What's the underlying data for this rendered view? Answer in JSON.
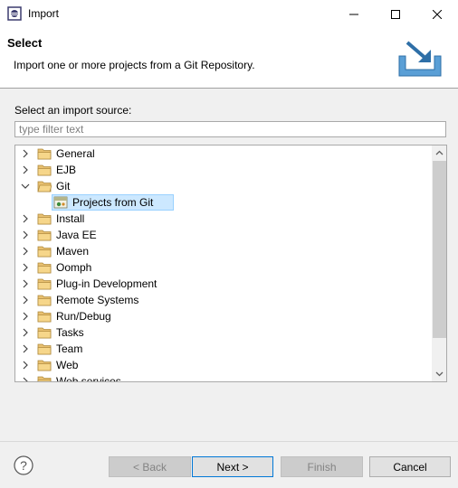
{
  "window": {
    "title": "Import",
    "icon": "eclipse-icon"
  },
  "header": {
    "title": "Select",
    "description": "Import one or more projects from a Git Repository.",
    "icon": "import-wizard-icon"
  },
  "main": {
    "source_label": "Select an import source:",
    "filter_placeholder": "type filter text",
    "tree": [
      {
        "label": "General",
        "expanded": false,
        "level": 0
      },
      {
        "label": "EJB",
        "expanded": false,
        "level": 0
      },
      {
        "label": "Git",
        "expanded": true,
        "level": 0
      },
      {
        "label": "Projects from Git",
        "level": 1,
        "selected": true,
        "icon": "git-repository-icon"
      },
      {
        "label": "Install",
        "expanded": false,
        "level": 0
      },
      {
        "label": "Java EE",
        "expanded": false,
        "level": 0
      },
      {
        "label": "Maven",
        "expanded": false,
        "level": 0
      },
      {
        "label": "Oomph",
        "expanded": false,
        "level": 0
      },
      {
        "label": "Plug-in Development",
        "expanded": false,
        "level": 0
      },
      {
        "label": "Remote Systems",
        "expanded": false,
        "level": 0
      },
      {
        "label": "Run/Debug",
        "expanded": false,
        "level": 0
      },
      {
        "label": "Tasks",
        "expanded": false,
        "level": 0
      },
      {
        "label": "Team",
        "expanded": false,
        "level": 0
      },
      {
        "label": "Web",
        "expanded": false,
        "level": 0
      },
      {
        "label": "Web services",
        "expanded": false,
        "level": 0
      }
    ]
  },
  "footer": {
    "back_label": "< Back",
    "next_label": "Next >",
    "finish_label": "Finish",
    "cancel_label": "Cancel"
  },
  "colors": {
    "selection": "#cce8ff",
    "selection_border": "#99d1ff",
    "folder": "#dcb462",
    "accent": "#0078d7"
  }
}
